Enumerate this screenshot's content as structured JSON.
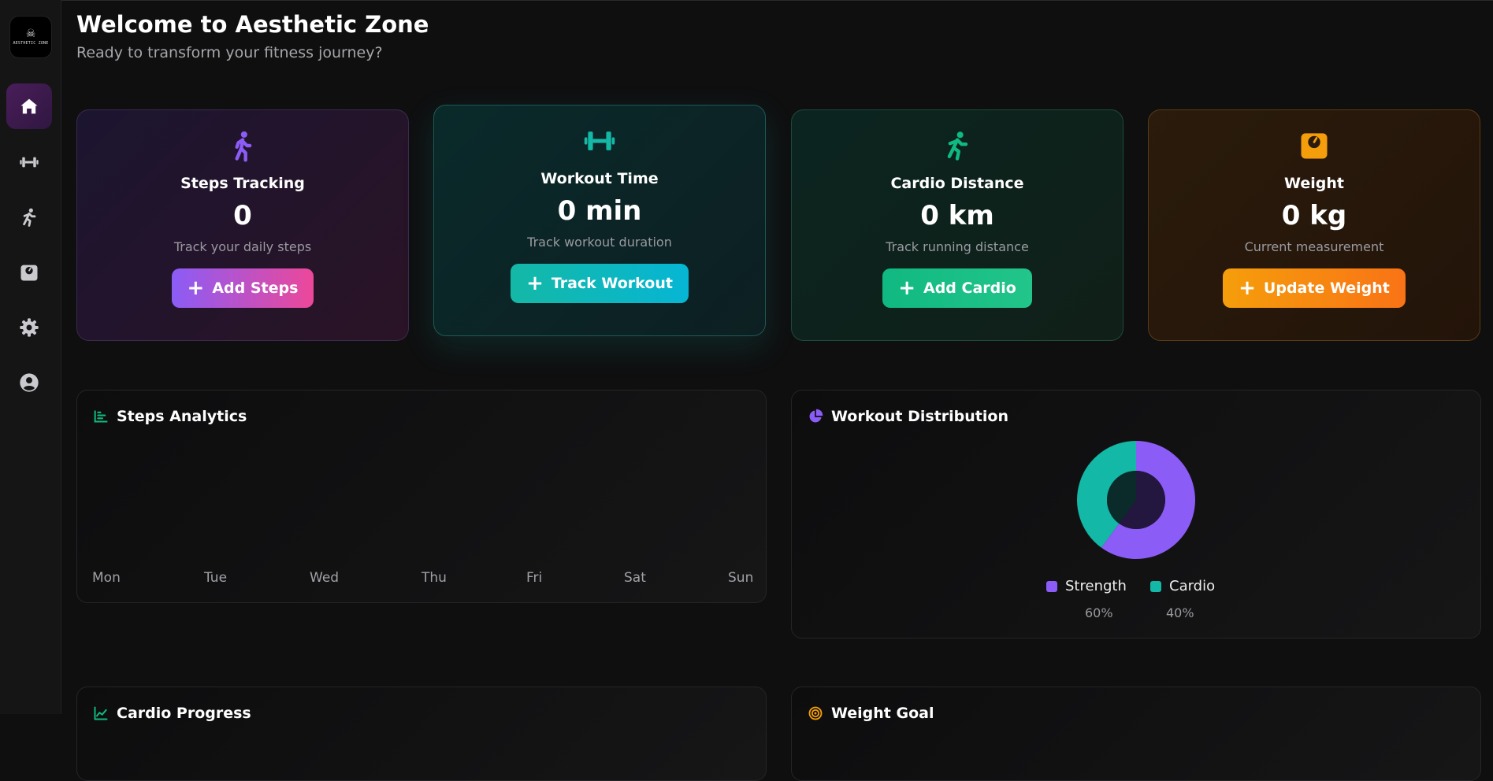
{
  "app": {
    "logo_text": "AESTHETIC ZONE",
    "title": "Welcome to Aesthetic Zone",
    "subtitle": "Ready to transform your fitness journey?"
  },
  "sidebar": {
    "items": [
      {
        "icon": "home-icon",
        "active": true
      },
      {
        "icon": "dumbbell-icon",
        "active": false
      },
      {
        "icon": "running-icon",
        "active": false
      },
      {
        "icon": "weight-scale-icon",
        "active": false
      },
      {
        "icon": "gear-icon",
        "active": false
      },
      {
        "icon": "user-circle-icon",
        "active": false
      }
    ]
  },
  "cards": [
    {
      "title": "Steps Tracking",
      "value": "0",
      "desc": "Track your daily steps",
      "button": "Add Steps",
      "icon": "walking-icon",
      "accent": "#8b5cf6"
    },
    {
      "title": "Workout Time",
      "value": "0 min",
      "desc": "Track workout duration",
      "button": "Track Workout",
      "icon": "dumbbell-icon",
      "accent": "#14b8a6"
    },
    {
      "title": "Cardio Distance",
      "value": "0 km",
      "desc": "Track running distance",
      "button": "Add Cardio",
      "icon": "running-icon",
      "accent": "#10b981"
    },
    {
      "title": "Weight",
      "value": "0 kg",
      "desc": "Current measurement",
      "button": "Update Weight",
      "icon": "weight-scale-icon",
      "accent": "#f59e0b"
    }
  ],
  "steps_analytics": {
    "title": "Steps Analytics",
    "days": [
      "Mon",
      "Tue",
      "Wed",
      "Thu",
      "Fri",
      "Sat",
      "Sun"
    ]
  },
  "workout_distribution": {
    "title": "Workout Distribution",
    "legend": [
      {
        "label": "Strength",
        "value": "60%",
        "color": "#8b5cf6"
      },
      {
        "label": "Cardio",
        "value": "40%",
        "color": "#14b8a6"
      }
    ]
  },
  "cardio_progress": {
    "title": "Cardio Progress"
  },
  "weight_goal": {
    "title": "Weight Goal"
  },
  "chart_data": [
    {
      "type": "bar",
      "categories": [
        "Mon",
        "Tue",
        "Wed",
        "Thu",
        "Fri",
        "Sat",
        "Sun"
      ],
      "values": [
        0,
        0,
        0,
        0,
        0,
        0,
        0
      ],
      "title": "Steps Analytics"
    },
    {
      "type": "pie",
      "categories": [
        "Strength",
        "Cardio"
      ],
      "values": [
        60,
        40
      ],
      "title": "Workout Distribution"
    }
  ]
}
